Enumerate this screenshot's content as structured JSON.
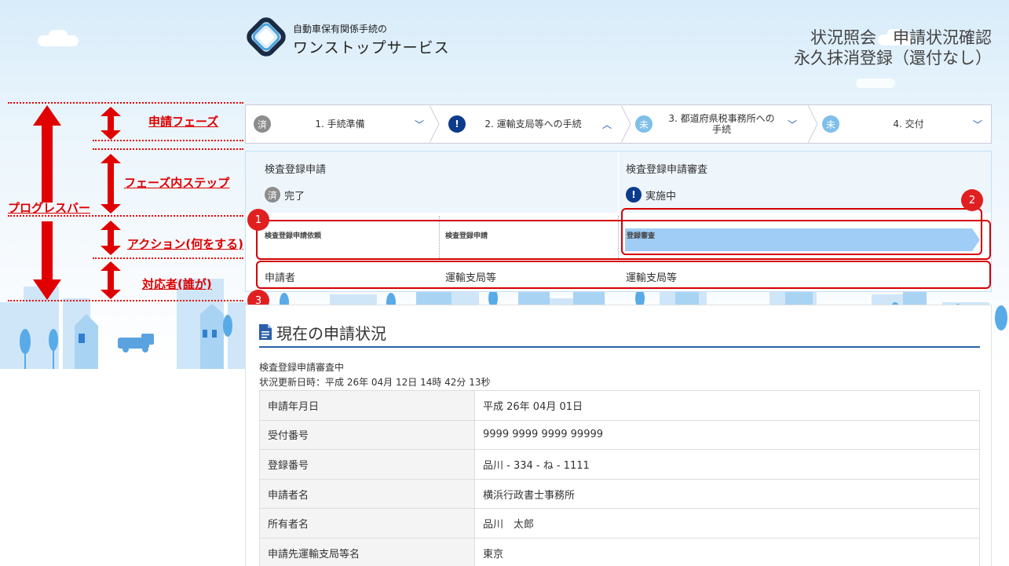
{
  "header": {
    "logo_small": "自動車保有関係手続の",
    "logo_big": "ワンストップサービス",
    "title_line1": "状況照会　申請状況確認",
    "title_line2": "永久抹消登録（還付なし）"
  },
  "annotations": {
    "progress_bar": "プログレスバー",
    "phase": "申請フェーズ",
    "phase_step": "フェーズ内ステップ",
    "action": "アクション(何をする)",
    "actor": "対応者(誰が)",
    "markers": [
      "1",
      "2",
      "3"
    ]
  },
  "phases": [
    {
      "badge": "済",
      "label": "1. 手続準備",
      "chevron": "﹀"
    },
    {
      "badge": "!",
      "label": "2. 運輸支局等への手続",
      "chevron": "︿"
    },
    {
      "badge": "未",
      "label_line1": "3. 都道府県税事務所への",
      "label_line2": "手続",
      "chevron": "﹀"
    },
    {
      "badge": "未",
      "label": "4. 交付",
      "chevron": "﹀"
    }
  ],
  "steps": [
    {
      "title": "検査登録申請",
      "badge": "済",
      "status": "完了"
    },
    {
      "title": "検査登録申請審査",
      "badge": "!",
      "status": "実施中"
    }
  ],
  "actions": [
    "検査登録申請依頼",
    "検査登録申請",
    "登録審査"
  ],
  "actors": [
    "申請者",
    "運輸支局等",
    "運輸支局等"
  ],
  "current": {
    "section_title": "現在の申請状況",
    "status_line": "検査登録申請審査中",
    "updated_line": "状況更新日時：平成 26年 04月 12日 14時 42分 13秒",
    "rows": [
      {
        "key": "申請年月日",
        "value": "平成 26年 04月 01日"
      },
      {
        "key": "受付番号",
        "value": "9999 9999 9999 99999"
      },
      {
        "key": "登録番号",
        "value": "品川 - 334 - ね - 1111"
      },
      {
        "key": "申請者名",
        "value": "横浜行政書士事務所"
      },
      {
        "key": "所有者名",
        "value": "品川　太郎"
      },
      {
        "key": "申請先運輸支局等名",
        "value": "東京"
      }
    ]
  },
  "colors": {
    "done_badge": "#8c8c8c",
    "active_badge": "#0d3b8c",
    "todo_badge": "#7fbfe9",
    "annotation_red": "#e00000",
    "active_step_bar": "#9fcdf5",
    "section_rule": "#2b5fa8"
  }
}
